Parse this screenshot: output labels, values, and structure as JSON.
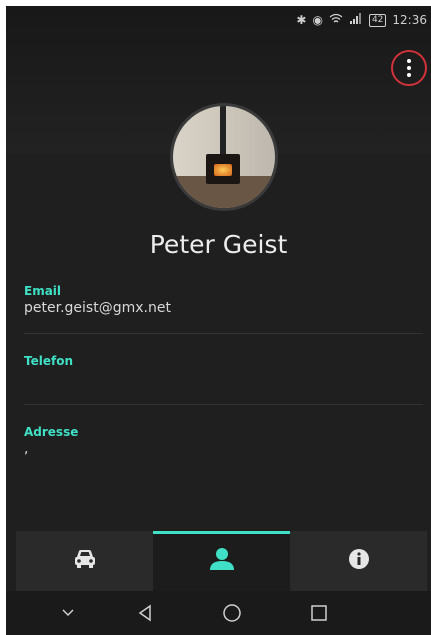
{
  "status_bar": {
    "battery": "42",
    "time": "12:36",
    "icons": [
      "bluetooth-icon",
      "eye-icon",
      "wifi-icon",
      "signal-icon",
      "battery-icon"
    ]
  },
  "profile": {
    "name": "Peter Geist"
  },
  "fields": {
    "email": {
      "label": "Email",
      "value": "peter.geist@gmx.net"
    },
    "phone": {
      "label": "Telefon",
      "value": ""
    },
    "address": {
      "label": "Adresse",
      "value": ","
    }
  },
  "bottom_nav": {
    "tabs": [
      "car-icon",
      "person-icon",
      "info-icon"
    ],
    "active_tab": "person-icon"
  },
  "system_nav": [
    "chevron-down-icon",
    "back-icon",
    "home-icon",
    "recents-icon"
  ],
  "colors": {
    "accent": "#3fe0c5",
    "background": "#1f1f1f",
    "highlight_ring": "#d0323a"
  }
}
